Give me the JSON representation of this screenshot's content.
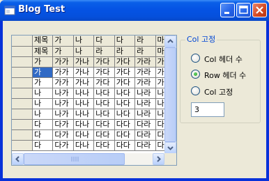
{
  "window": {
    "title": "Blog Test"
  },
  "grid": {
    "rows": [
      {
        "kind": "header",
        "cells": [
          "",
          "제목",
          "가",
          "나",
          "다",
          "다",
          "라",
          "마"
        ]
      },
      {
        "kind": "header",
        "cells": [
          "",
          "제목",
          "가",
          "나",
          "라",
          "라",
          "라",
          "마"
        ]
      },
      {
        "kind": "header",
        "cells": [
          "",
          "가",
          "가가",
          "가나",
          "가다",
          "가다",
          "가라",
          "가마"
        ]
      },
      {
        "kind": "data",
        "cells": [
          "",
          "가",
          "가가",
          "가나",
          "가다",
          "가다",
          "가라",
          "가마"
        ],
        "selected": 1
      },
      {
        "kind": "data",
        "cells": [
          "",
          "가",
          "가가",
          "가나",
          "가다",
          "가다",
          "가라",
          "가마"
        ]
      },
      {
        "kind": "data",
        "cells": [
          "",
          "나",
          "나가",
          "나나",
          "나다",
          "나다",
          "나라",
          "나마"
        ]
      },
      {
        "kind": "data",
        "cells": [
          "",
          "나",
          "나가",
          "나나",
          "나다",
          "나다",
          "나라",
          "나마"
        ]
      },
      {
        "kind": "data",
        "cells": [
          "",
          "나",
          "나가",
          "나나",
          "나다",
          "나다",
          "나라",
          "나마"
        ]
      },
      {
        "kind": "data",
        "cells": [
          "",
          "다",
          "다가",
          "다나",
          "다다",
          "다다",
          "다라",
          "다마"
        ]
      },
      {
        "kind": "data",
        "cells": [
          "",
          "다",
          "다가",
          "다나",
          "다다",
          "다다",
          "다라",
          "다마"
        ]
      },
      {
        "kind": "data",
        "cells": [
          "",
          "다",
          "다가",
          "다나",
          "다다",
          "다다",
          "다라",
          "다마"
        ]
      }
    ]
  },
  "group": {
    "title": "Col 고정",
    "options": [
      {
        "label": "Col 헤더 수",
        "checked": false
      },
      {
        "label": "Row 헤더 수",
        "checked": true
      },
      {
        "label": "Col 고정",
        "checked": false
      }
    ],
    "value": "3"
  },
  "colors": {
    "title_bar": "#0553e4",
    "selection": "#316ac5",
    "group_title": "#0046d5"
  }
}
